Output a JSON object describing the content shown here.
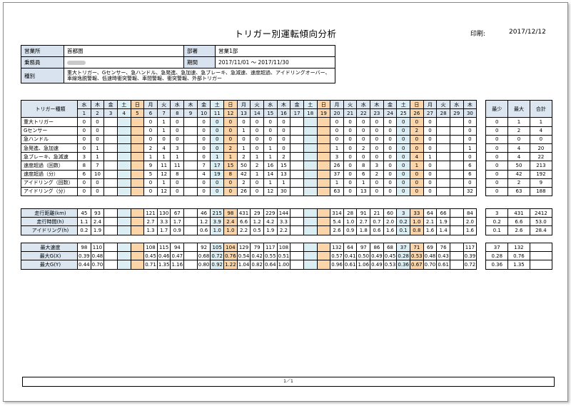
{
  "title": "トリガー別運転傾向分析",
  "print_label": "印刷:",
  "print_date": "2017/12/12",
  "info": {
    "office_label": "営業所",
    "office": "首都圏",
    "dept_label": "部署",
    "dept": "営業1部",
    "driver_label": "乗務員",
    "period_label": "期間",
    "period": "2017/11/01 ～ 2017/11/30",
    "kind_label": "種別",
    "kinds": "重大トリガー、Gセンサー、急ハンドル、急発進、急加速、急ブレーキ、急減速、速度超過、アイドリングオーバー、車線逸脱警報、低速時衝突警報、車間警報、衝突警報、外部トリガー"
  },
  "table": {
    "header_name": "トリガー種類",
    "weekdays": [
      "水",
      "木",
      "金",
      "土",
      "日",
      "月",
      "火",
      "水",
      "木",
      "金",
      "土",
      "日",
      "月",
      "火",
      "水",
      "木",
      "金",
      "土",
      "日",
      "月",
      "火",
      "水",
      "木",
      "金",
      "土",
      "日",
      "月",
      "火",
      "水",
      "木"
    ],
    "days": [
      "1",
      "2",
      "3",
      "4",
      "5",
      "6",
      "7",
      "8",
      "9",
      "10",
      "11",
      "12",
      "13",
      "14",
      "15",
      "16",
      "17",
      "18",
      "19",
      "20",
      "21",
      "22",
      "23",
      "24",
      "25",
      "26",
      "27",
      "28",
      "29",
      "30"
    ],
    "summary_headers": [
      "最少",
      "最大",
      "合計"
    ],
    "section1": [
      {
        "name": "重大トリガー",
        "cells": [
          "0",
          "0",
          "",
          "",
          "",
          "0",
          "1",
          "0",
          "",
          "0",
          "0",
          "0",
          "0",
          "0",
          "0",
          "0",
          "",
          "",
          "",
          "0",
          "0",
          "0",
          "0",
          "0",
          "0",
          "0",
          "0",
          "",
          "",
          "0"
        ],
        "summary": [
          "0",
          "1",
          "1"
        ]
      },
      {
        "name": "Gセンサー",
        "cells": [
          "0",
          "0",
          "",
          "",
          "",
          "0",
          "1",
          "0",
          "",
          "0",
          "0",
          "0",
          "1",
          "0",
          "0",
          "0",
          "",
          "",
          "",
          "0",
          "0",
          "0",
          "0",
          "0",
          "0",
          "2",
          "0",
          "",
          "",
          "0"
        ],
        "summary": [
          "0",
          "2",
          "4"
        ]
      },
      {
        "name": "急ハンドル",
        "cells": [
          "0",
          "0",
          "",
          "",
          "",
          "0",
          "0",
          "0",
          "",
          "0",
          "0",
          "0",
          "0",
          "0",
          "0",
          "0",
          "",
          "",
          "",
          "0",
          "0",
          "0",
          "0",
          "0",
          "0",
          "0",
          "0",
          "",
          "",
          "0"
        ],
        "summary": [
          "0",
          "0",
          "0"
        ]
      },
      {
        "name": "急発進、急加速",
        "cells": [
          "0",
          "1",
          "",
          "",
          "",
          "2",
          "4",
          "3",
          "",
          "0",
          "0",
          "2",
          "1",
          "0",
          "1",
          "0",
          "",
          "",
          "",
          "1",
          "0",
          "2",
          "0",
          "0",
          "0",
          "0",
          "0",
          "",
          "",
          "1"
        ],
        "summary": [
          "0",
          "4",
          "20"
        ]
      },
      {
        "name": "急ブレーキ、急減速",
        "cells": [
          "3",
          "1",
          "",
          "",
          "",
          "1",
          "1",
          "1",
          "",
          "0",
          "1",
          "1",
          "2",
          "1",
          "1",
          "2",
          "",
          "",
          "",
          "3",
          "0",
          "0",
          "0",
          "0",
          "0",
          "4",
          "1",
          "",
          "",
          "0"
        ],
        "summary": [
          "0",
          "4",
          "22"
        ]
      },
      {
        "name": "速度超過（回数）",
        "cells": [
          "8",
          "7",
          "",
          "",
          "",
          "9",
          "11",
          "11",
          "",
          "7",
          "17",
          "15",
          "50",
          "2",
          "16",
          "15",
          "",
          "",
          "",
          "26",
          "0",
          "8",
          "3",
          "0",
          "0",
          "1",
          "0",
          "",
          "",
          "6"
        ],
        "summary": [
          "0",
          "50",
          "213"
        ]
      },
      {
        "name": "速度超過（分）",
        "cells": [
          "6",
          "10",
          "",
          "",
          "",
          "5",
          "12",
          "8",
          "",
          "4",
          "19",
          "8",
          "42",
          "1",
          "14",
          "13",
          "",
          "",
          "",
          "37",
          "0",
          "6",
          "2",
          "0",
          "0",
          "0",
          "0",
          "",
          "",
          "6"
        ],
        "summary": [
          "0",
          "42",
          "192"
        ]
      },
      {
        "name": "アイドリング（回数）",
        "cells": [
          "0",
          "0",
          "",
          "",
          "",
          "0",
          "1",
          "0",
          "",
          "0",
          "0",
          "0",
          "2",
          "0",
          "1",
          "1",
          "",
          "",
          "",
          "1",
          "0",
          "1",
          "0",
          "0",
          "0",
          "0",
          "0",
          "",
          "",
          "0"
        ],
        "summary": [
          "0",
          "2",
          "9"
        ]
      },
      {
        "name": "アイドリング（分）",
        "cells": [
          "0",
          "0",
          "",
          "",
          "",
          "0",
          "12",
          "0",
          "",
          "0",
          "0",
          "0",
          "26",
          "0",
          "12",
          "30",
          "",
          "",
          "",
          "63",
          "0",
          "13",
          "0",
          "0",
          "0",
          "0",
          "0",
          "",
          "",
          "32"
        ],
        "summary": [
          "0",
          "63",
          "188"
        ]
      }
    ],
    "section2": [
      {
        "name": "走行距離(km)",
        "cells": [
          "45",
          "93",
          "",
          "",
          "",
          "121",
          "130",
          "67",
          "",
          "46",
          "215",
          "98",
          "431",
          "29",
          "229",
          "144",
          "",
          "",
          "",
          "314",
          "28",
          "91",
          "21",
          "60",
          "3",
          "33",
          "64",
          "66",
          "",
          "84"
        ],
        "summary": [
          "3",
          "431",
          "2412"
        ]
      },
      {
        "name": "走行時間(h)",
        "cells": [
          "1.1",
          "2.4",
          "",
          "",
          "",
          "2.7",
          "3.3",
          "1.7",
          "",
          "1.2",
          "3.9",
          "2.4",
          "6.6",
          "1.2",
          "4.2",
          "3.3",
          "",
          "",
          "",
          "5.4",
          "1.0",
          "2.7",
          "0.7",
          "2.0",
          "0.2",
          "1.0",
          "2.1",
          "1.9",
          "",
          "2.0"
        ],
        "summary": [
          "0.2",
          "6.6",
          "53.0"
        ]
      },
      {
        "name": "アイドリング(h)",
        "cells": [
          "0.2",
          "1.9",
          "",
          "",
          "",
          "1.3",
          "1.7",
          "0.9",
          "",
          "0.6",
          "1.0",
          "1.0",
          "2.2",
          "0.5",
          "1.9",
          "2.2",
          "",
          "",
          "",
          "2.6",
          "0.9",
          "1.8",
          "0.6",
          "1.6",
          "0.1",
          "0.8",
          "1.6",
          "1.4",
          "",
          "1.6"
        ],
        "summary": [
          "0.1",
          "2.6",
          "28.4"
        ]
      }
    ],
    "section3": [
      {
        "name": "最大速度",
        "cells": [
          "98",
          "110",
          "",
          "",
          "",
          "108",
          "115",
          "94",
          "",
          "92",
          "105",
          "104",
          "129",
          "79",
          "117",
          "108",
          "",
          "",
          "",
          "132",
          "64",
          "97",
          "86",
          "68",
          "37",
          "71",
          "69",
          "76",
          "",
          "117"
        ],
        "summary": [
          "37",
          "132",
          ""
        ]
      },
      {
        "name": "最大G(X)",
        "cells": [
          "0.39",
          "0.48",
          "",
          "",
          "",
          "0.45",
          "0.46",
          "0.47",
          "",
          "0.68",
          "0.72",
          "0.76",
          "0.54",
          "0.42",
          "0.55",
          "0.51",
          "",
          "",
          "",
          "0.57",
          "0.41",
          "0.50",
          "0.49",
          "0.45",
          "0.28",
          "0.53",
          "0.48",
          "0.43",
          "",
          "0.39"
        ],
        "summary": [
          "0.28",
          "0.76",
          ""
        ]
      },
      {
        "name": "最大G(Y)",
        "cells": [
          "0.44",
          "0.70",
          "",
          "",
          "",
          "0.71",
          "1.35",
          "1.16",
          "",
          "0.80",
          "0.92",
          "1.22",
          "1.04",
          "0.82",
          "0.64",
          "1.00",
          "",
          "",
          "",
          "0.96",
          "0.61",
          "1.06",
          "0.49",
          "0.53",
          "0.36",
          "0.67",
          "0.70",
          "0.61",
          "",
          "0.72"
        ],
        "summary": [
          "0.36",
          "1.35",
          ""
        ]
      }
    ]
  },
  "footer": "1／1"
}
